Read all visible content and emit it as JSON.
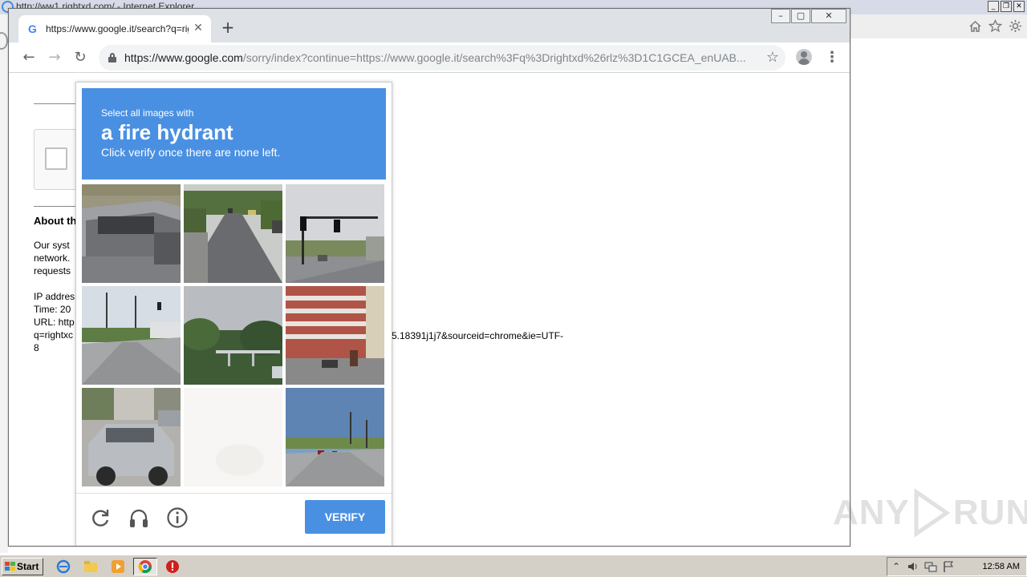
{
  "ie_window": {
    "title": "http://ww1.rightxd.com/ - Internet Explorer",
    "controls": [
      "_",
      "❐",
      "✕"
    ],
    "toolbar_icons": [
      "home-icon",
      "star-icon",
      "gear-icon"
    ]
  },
  "chrome": {
    "tab": {
      "favicon": "G",
      "title": "https://www.google.it/search?q=rightxd",
      "close": "✕"
    },
    "new_tab": "+",
    "window_controls": [
      "–",
      "▢",
      "✕"
    ],
    "nav": {
      "back": "←",
      "forward": "→",
      "reload": "↻"
    },
    "address": {
      "host": "https://www.google.com",
      "path": "/sorry/index?continue=https://www.google.it/search%3Fq%3Drightxd%26rlz%3D1C1GCEA_enUAB..."
    },
    "bookmark_star": "☆",
    "menu": "⋮"
  },
  "page": {
    "about_heading": "About th",
    "lines": [
      "Our syst",
      "network.",
      "requests",
      "",
      "IP addres",
      "Time: 20",
      "URL: http",
      "q=rightxc",
      "8"
    ],
    "url_tail": "5.18391j1j7&sourceid=chrome&ie=UTF-"
  },
  "recaptcha": {
    "prompt": "Select all images with",
    "target": "a fire hydrant",
    "instruction": "Click verify once there are none left.",
    "verify_label": "VERIFY",
    "tiles": [
      {
        "name": "pickup-truck"
      },
      {
        "name": "tree-lined-road"
      },
      {
        "name": "traffic-light-intersection"
      },
      {
        "name": "utility-poles-road"
      },
      {
        "name": "bridge-trees"
      },
      {
        "name": "red-brick-building"
      },
      {
        "name": "parked-suv"
      },
      {
        "name": "faded-blank"
      },
      {
        "name": "highway-road"
      }
    ],
    "colors": {
      "header": "#4a90e2",
      "button": "#4a90e2"
    }
  },
  "watermark": {
    "left": "ANY",
    "right": "RUN"
  },
  "taskbar": {
    "start_label": "Start",
    "clock": "12:58 AM"
  }
}
